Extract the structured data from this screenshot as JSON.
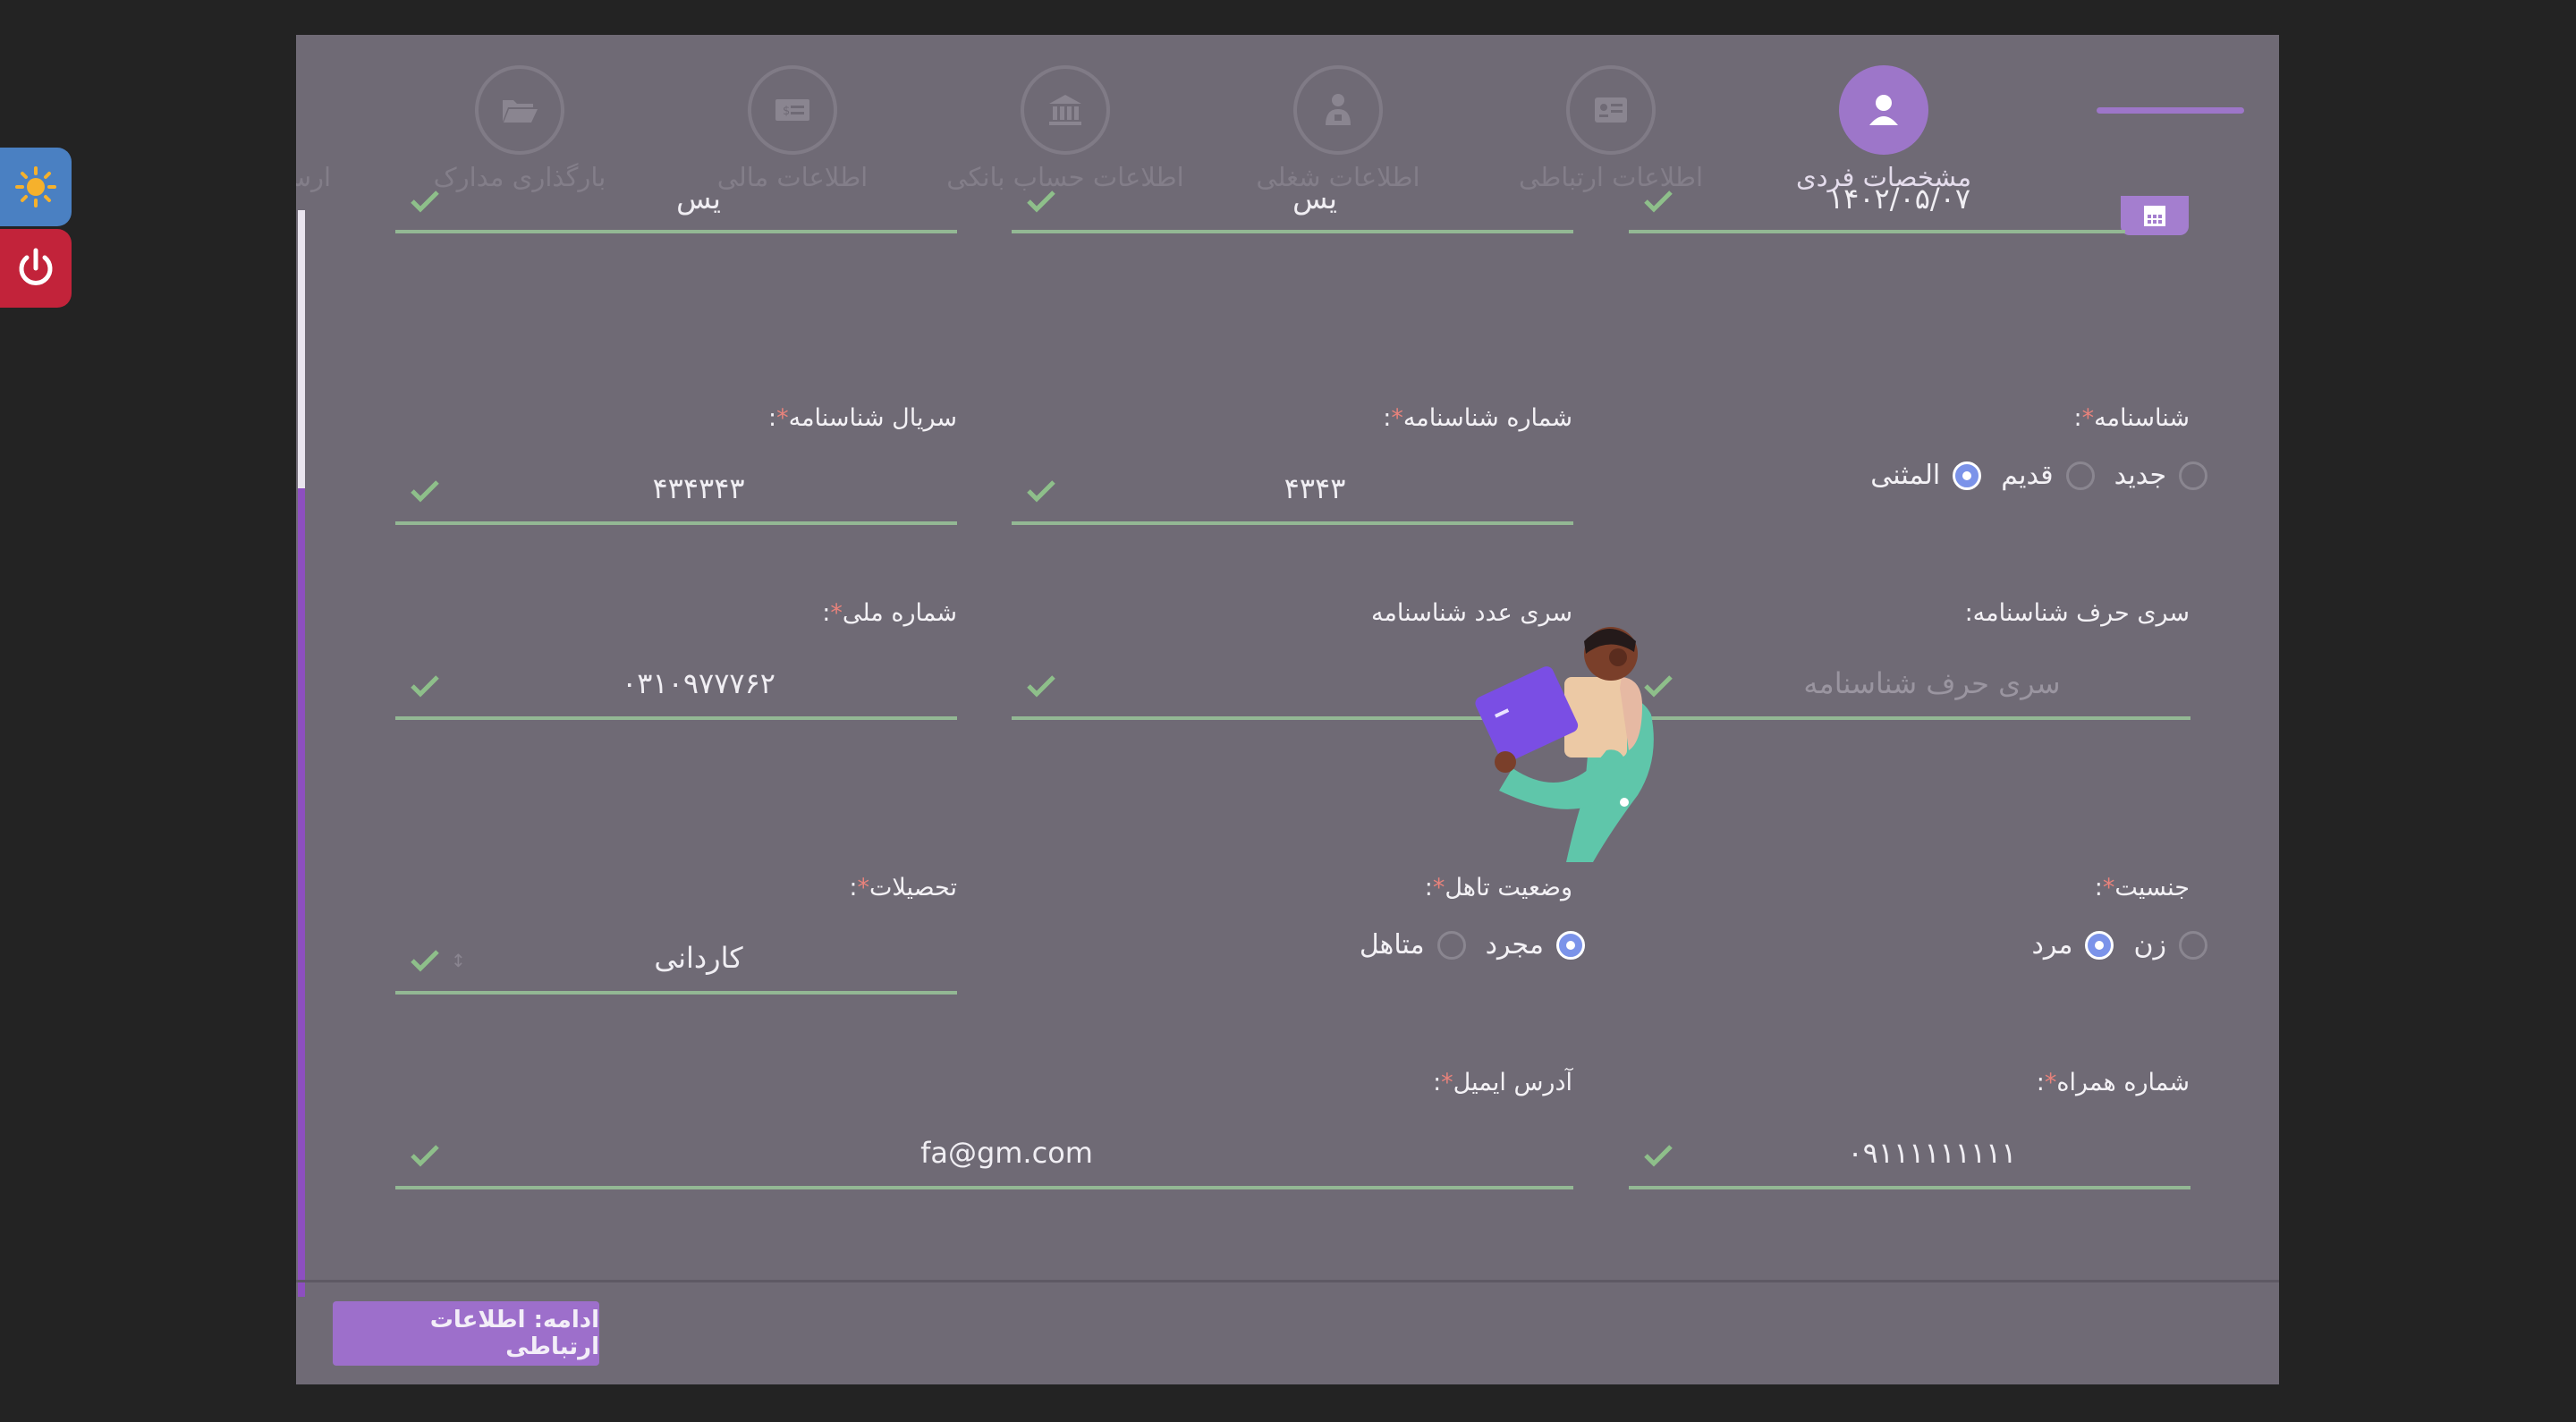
{
  "stepper": {
    "steps": [
      {
        "label": "مشخصات فردی",
        "icon": "user-icon",
        "active": true
      },
      {
        "label": "اطلاعات ارتباطی",
        "icon": "contact-card-icon",
        "active": false
      },
      {
        "label": "اطلاعات شغلی",
        "icon": "briefcase-person-icon",
        "active": false
      },
      {
        "label": "اطلاعات حساب بانکی",
        "icon": "bank-icon",
        "active": false
      },
      {
        "label": "اطلاعات مالی",
        "icon": "money-icon",
        "active": false
      },
      {
        "label": "بارگذاری مدارک",
        "icon": "folder-open-icon",
        "active": false
      },
      {
        "label": "ارسال به سجام",
        "icon": "cloud-upload-icon",
        "active": false
      }
    ]
  },
  "form": {
    "top_row": {
      "birth_date_value": "۱۴۰۲/۰۵/۰۷",
      "field2_value": "یس",
      "field3_value": "یس"
    },
    "id_card_type": {
      "label": "شناسنامه",
      "options": [
        "جدید",
        "قدیم",
        "المثنی"
      ],
      "selected": "المثنی"
    },
    "id_number": {
      "label": "شماره شناسنامه",
      "value": "۴۳۴۳"
    },
    "id_serial": {
      "label": "سریال شناسنامه",
      "value": "۴۳۴۳۴۳"
    },
    "id_letter_series": {
      "label": "سری حرف شناسنامه:",
      "placeholder": "سری حرف شناسنامه"
    },
    "id_number_series": {
      "label": "سری عدد شناسنامه"
    },
    "national_id": {
      "label": "شماره ملی",
      "value": "۰۳۱۰۹۷۷۷۶۲"
    },
    "gender": {
      "label": "جنسیت",
      "options": [
        "زن",
        "مرد"
      ],
      "selected": "مرد"
    },
    "marital": {
      "label": "وضعیت تاهل",
      "options": [
        "مجرد",
        "متاهل"
      ],
      "selected": "مجرد"
    },
    "education": {
      "label": "تحصیلات",
      "value": "کاردانی"
    },
    "mobile": {
      "label": "شماره همراه",
      "value": "۰۹۱۱۱۱۱۱۱۱۱"
    },
    "email": {
      "label": "آدرس ایمیل",
      "value": "fa@gm.com"
    }
  },
  "footer": {
    "continue_label": "ادامه: اطلاعات ارتباطی"
  },
  "colors": {
    "accent": "#9d76c9",
    "valid": "#93b894",
    "danger": "#c2233a",
    "theme_button": "#4a80c2"
  }
}
